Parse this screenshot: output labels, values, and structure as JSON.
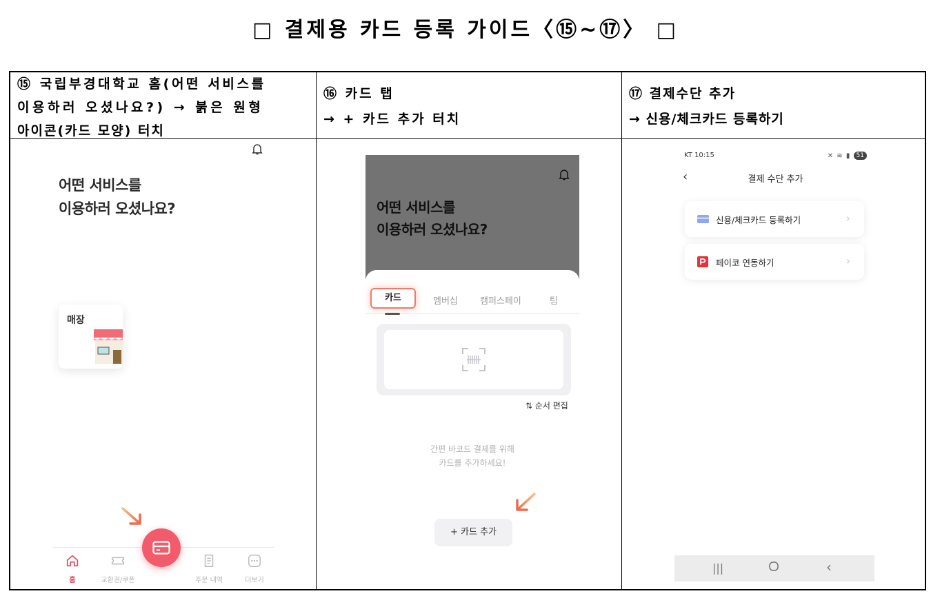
{
  "document": {
    "title": "□ 결제용 카드 등록 가이드〈⑮~⑰〉 □"
  },
  "steps": [
    {
      "lines": [
        "⑮ 국립부경대학교 홈(어떤 서비스를",
        "이용하러 오셨나요?) → 붉은 원형",
        "아이콘(카드 모양) 터치"
      ]
    },
    {
      "lines": [
        "⑯ 카드 탭",
        "→ + 카드 추가 터치"
      ]
    },
    {
      "lines": [
        "⑰ 결제수단 추가",
        "→ 신용/체크카드 등록하기"
      ]
    }
  ],
  "panel1": {
    "greeting_line1": "어떤 서비스를",
    "greeting_line2": "이용하러 오셨나요?",
    "store_label": "매장",
    "nav": [
      {
        "label": "홈",
        "icon": "home-icon",
        "active": true
      },
      {
        "label": "교환권/쿠폰",
        "icon": "ticket-icon",
        "active": false
      },
      {
        "label": "주문 내역",
        "icon": "receipt-icon",
        "active": false
      },
      {
        "label": "더보기",
        "icon": "more-icon",
        "active": false
      }
    ],
    "fab_icon": "card-icon",
    "accent": "#f25b6c"
  },
  "panel2": {
    "greeting_line1": "어떤 서비스를",
    "greeting_line2": "이용하러 오셨나요?",
    "tabs": [
      "카드",
      "멤버십",
      "캠퍼스페이",
      "팀"
    ],
    "reorder_label": "⇅ 순서 편집",
    "empty_line1": "간편 바코드 결제를 위해",
    "empty_line2": "카드를 추가하세요!",
    "add_card_label": "+ 카드 추가"
  },
  "panel3": {
    "status_time": "KT 10:15",
    "battery": "51",
    "title": "결제 수단 추가",
    "options": [
      {
        "label": "신용/체크카드 등록하기",
        "icon": "credit-card-icon"
      },
      {
        "label": "페이코 연동하기",
        "icon": "payco-icon"
      }
    ]
  }
}
